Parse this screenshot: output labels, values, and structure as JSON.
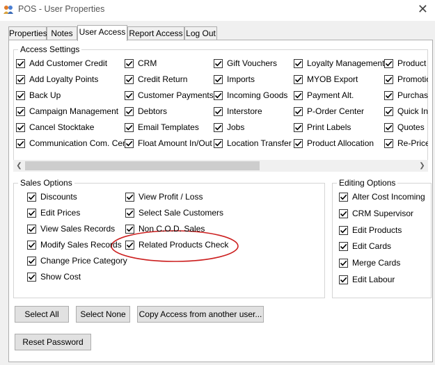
{
  "window": {
    "title": "POS - User Properties",
    "close_glyph": "✕"
  },
  "tabs": [
    {
      "label": "Properties",
      "active": false
    },
    {
      "label": "Notes",
      "active": false
    },
    {
      "label": "User Access",
      "active": true
    },
    {
      "label": "Report Access",
      "active": false
    },
    {
      "label": "Log Out",
      "active": false
    }
  ],
  "access_settings": {
    "title": "Access Settings",
    "columns": [
      [
        "Add Customer Credit",
        "Add Loyalty Points",
        "Back Up",
        "Campaign Management",
        "Cancel Stocktake",
        "Communication Com. Cen."
      ],
      [
        "CRM",
        "Credit Return",
        "Customer Payments",
        "Debtors",
        "Email Templates",
        "Float Amount In/Out"
      ],
      [
        "Gift Vouchers",
        "Imports",
        "Incoming Goods",
        "Interstore",
        "Jobs",
        "Location Transfer"
      ],
      [
        "Loyalty Management",
        "MYOB Export",
        "Payment Alt.",
        "P-Order Center",
        "Print Labels",
        "Product Allocation"
      ],
      [
        "Product",
        "Promotio",
        "Purchase",
        "Quick In",
        "Quotes",
        "Re-Price"
      ]
    ],
    "scroll_left_glyph": "❮",
    "scroll_right_glyph": "❯"
  },
  "sales_options": {
    "title": "Sales Options",
    "col1": [
      "Discounts",
      "Edit Prices",
      "View Sales Records",
      "Modify Sales Records",
      "Change Price Category",
      "Show Cost"
    ],
    "col2": [
      "View Profit / Loss",
      "Select Sale Customers",
      "Non C.O.D. Sales",
      "Related Products Check"
    ]
  },
  "editing_options": {
    "title": "Editing Options",
    "items": [
      "Alter Cost Incoming",
      "CRM Supervisor",
      "Edit Products",
      "Edit Cards",
      "Merge Cards",
      "Edit Labour"
    ]
  },
  "buttons": {
    "select_all": "Select All",
    "select_none": "Select None",
    "copy_access": "Copy Access from another user...",
    "reset_password": "Reset Password"
  },
  "colors": {
    "annotation": "#cc1f1f",
    "scroll_thumb": "#cdcdcd"
  },
  "icons": {
    "app": "pos-app-icon",
    "check": "check-icon"
  }
}
